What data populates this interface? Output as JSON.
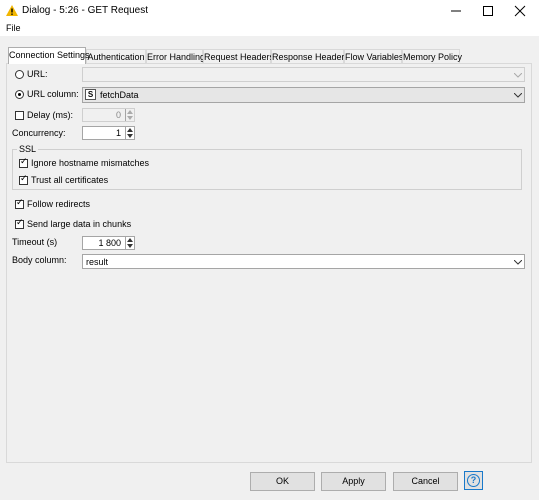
{
  "window": {
    "title": "Dialog - 5:26 - GET Request",
    "menu": [
      "File"
    ],
    "controls": [
      "minimize-icon",
      "maximize-icon",
      "close-icon"
    ]
  },
  "tabs": [
    {
      "label": "Connection Settings",
      "active": true
    },
    {
      "label": "Authentication",
      "active": false
    },
    {
      "label": "Error Handling",
      "active": false
    },
    {
      "label": "Request Headers",
      "active": false
    },
    {
      "label": "Response Headers",
      "active": false
    },
    {
      "label": "Flow Variables",
      "active": false
    },
    {
      "label": "Memory Policy",
      "active": false
    }
  ],
  "form": {
    "url_label": "URL:",
    "url_value": "",
    "url_column_label": "URL column:",
    "url_column_type_badge": "S",
    "url_column_value": "fetchData",
    "delay_label": "Delay (ms):",
    "delay_value": "0",
    "concurrency_label": "Concurrency:",
    "concurrency_value": "1",
    "ssl_group_label": "SSL",
    "ignore_hostname_label": "Ignore hostname mismatches",
    "trust_all_label": "Trust all certificates",
    "follow_redirects_label": "Follow redirects",
    "send_chunks_label": "Send large data in chunks",
    "timeout_label": "Timeout (s)",
    "timeout_value": "1 800",
    "body_column_label": "Body column:",
    "body_column_value": "result"
  },
  "buttons": {
    "ok": "OK",
    "apply": "Apply",
    "cancel": "Cancel",
    "help": "?"
  },
  "colors": {
    "accent": "#1979ca",
    "warning_icon": "#f2b600"
  }
}
